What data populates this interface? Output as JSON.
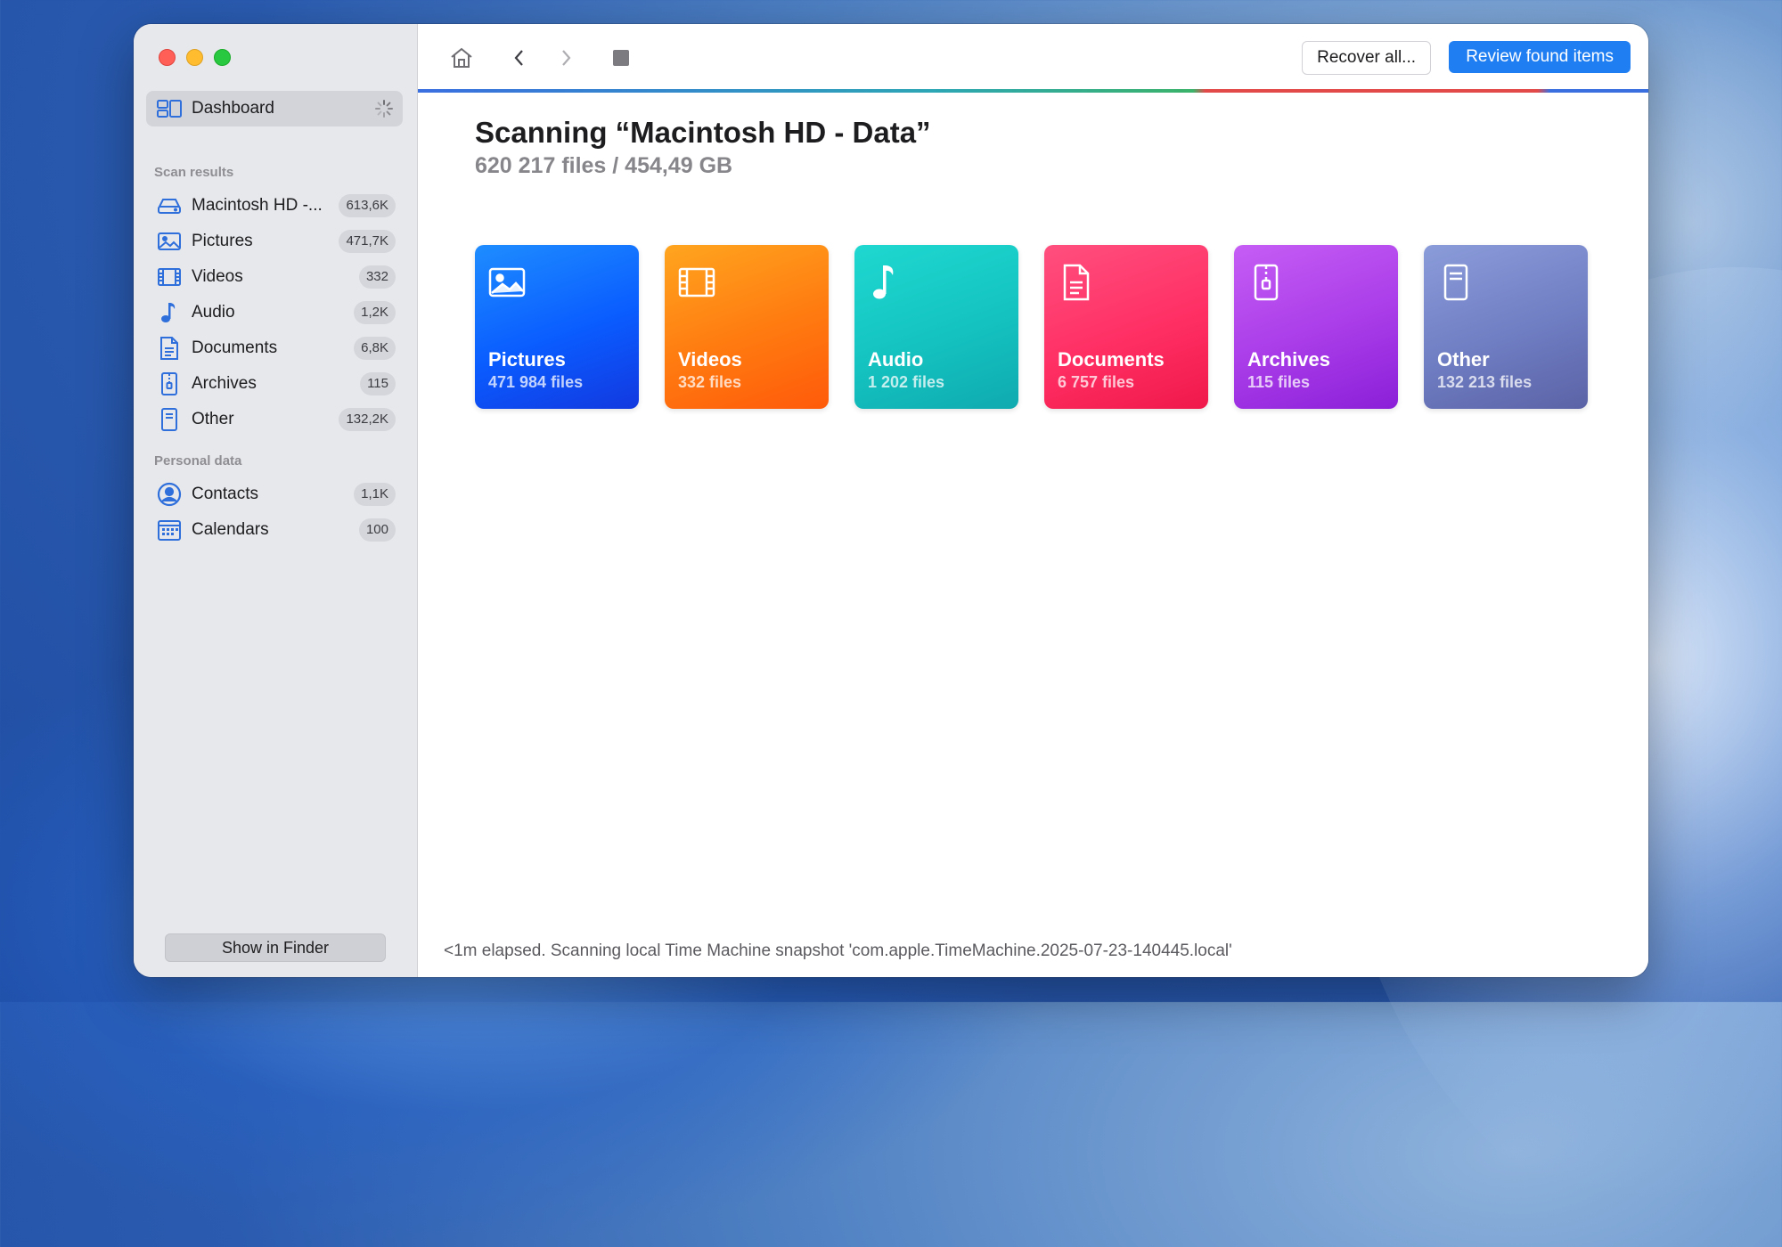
{
  "sidebar": {
    "dashboard_label": "Dashboard",
    "scan_results_label": "Scan results",
    "personal_data_label": "Personal data",
    "scan_results": [
      {
        "label": "Macintosh HD -...",
        "count": "613,6K",
        "icon": "hard-drive-icon"
      },
      {
        "label": "Pictures",
        "count": "471,7K",
        "icon": "picture-icon"
      },
      {
        "label": "Videos",
        "count": "332",
        "icon": "film-icon"
      },
      {
        "label": "Audio",
        "count": "1,2K",
        "icon": "music-note-icon"
      },
      {
        "label": "Documents",
        "count": "6,8K",
        "icon": "document-icon"
      },
      {
        "label": "Archives",
        "count": "115",
        "icon": "archive-icon"
      },
      {
        "label": "Other",
        "count": "132,2K",
        "icon": "other-file-icon"
      }
    ],
    "personal_data": [
      {
        "label": "Contacts",
        "count": "1,1K",
        "icon": "contact-icon"
      },
      {
        "label": "Calendars",
        "count": "100",
        "icon": "calendar-icon"
      }
    ],
    "show_in_finder_label": "Show in Finder"
  },
  "toolbar": {
    "recover_all_label": "Recover all...",
    "review_found_label": "Review found items"
  },
  "main": {
    "title": "Scanning “Macintosh HD - Data”",
    "subtitle": "620 217 files / 454,49 GB",
    "cards": [
      {
        "title": "Pictures",
        "sub": "471 984 files",
        "icon": "picture-icon"
      },
      {
        "title": "Videos",
        "sub": "332 files",
        "icon": "film-icon"
      },
      {
        "title": "Audio",
        "sub": "1 202 files",
        "icon": "music-note-icon"
      },
      {
        "title": "Documents",
        "sub": "6 757 files",
        "icon": "document-icon"
      },
      {
        "title": "Archives",
        "sub": "115 files",
        "icon": "archive-icon"
      },
      {
        "title": "Other",
        "sub": "132 213 files",
        "icon": "other-file-icon"
      }
    ],
    "status": "<1m elapsed. Scanning local Time Machine snapshot 'com.apple.TimeMachine.2025-07-23-140445.local'"
  },
  "colors": {
    "accent": "#1f7ef2",
    "sidebar_icon": "#2f6fdb"
  }
}
